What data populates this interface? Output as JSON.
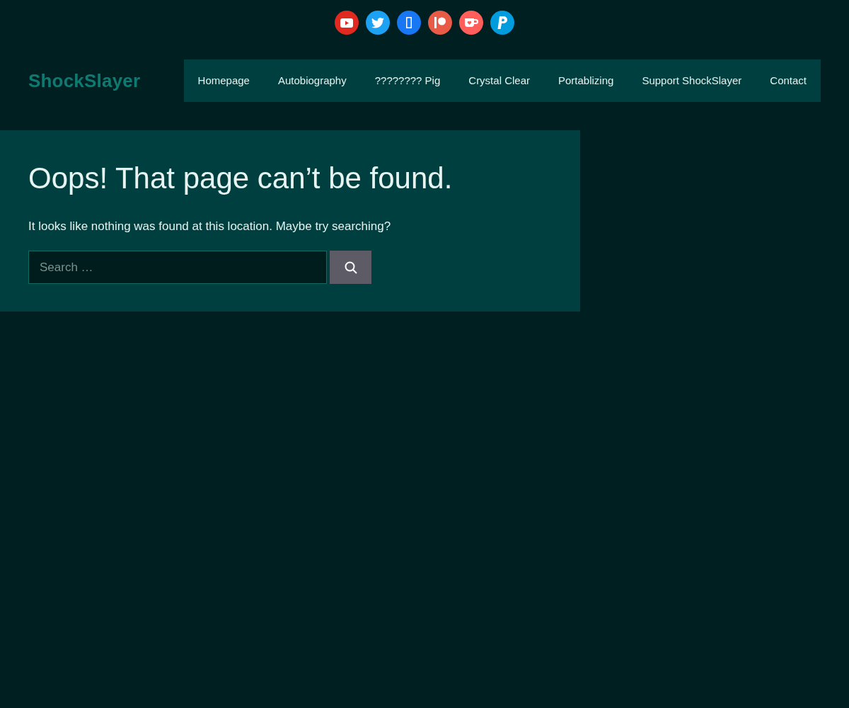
{
  "social_links": [
    {
      "kind": "youtube",
      "color": "#e02a20"
    },
    {
      "kind": "twitter",
      "color": "#1da1f2"
    },
    {
      "kind": "missing",
      "color": "#1877f2"
    },
    {
      "kind": "patreon",
      "color": "#e85b46"
    },
    {
      "kind": "kofi",
      "color": "#ff5e5b"
    },
    {
      "kind": "paypal",
      "color": "#009cde"
    }
  ],
  "site_title": "ShockSlayer",
  "nav": {
    "items": [
      "Homepage",
      "Autobiography",
      "???????? Pig",
      "Crystal Clear",
      "Portablizing",
      "Support ShockSlayer",
      "Contact"
    ]
  },
  "content": {
    "heading": "Oops! That page can’t be found.",
    "message": "It looks like nothing was found at this location. Maybe try searching?",
    "search": {
      "placeholder": "Search …"
    }
  }
}
